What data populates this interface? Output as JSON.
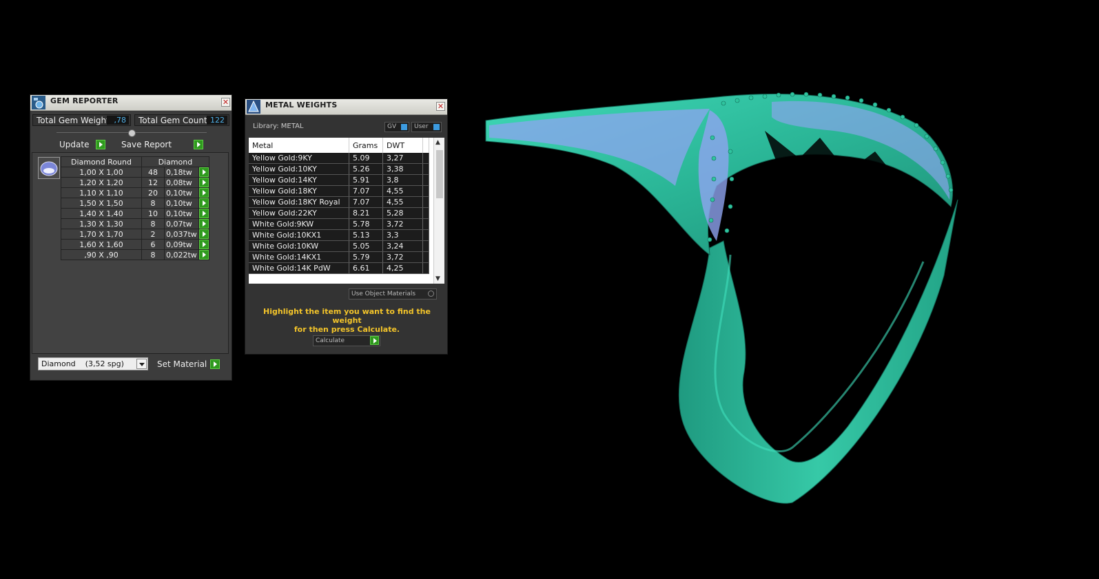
{
  "gem_reporter": {
    "title": "GEM REPORTER",
    "total_weight_label": "Total Gem Weight",
    "total_weight_value": ",78",
    "total_count_label": "Total Gem Count",
    "total_count_value": "122",
    "update_label": "Update",
    "save_report_label": "Save Report",
    "table_headers": [
      "Diamond Round",
      "Diamond"
    ],
    "rows": [
      {
        "size": "1,00 X 1,00",
        "count": "48",
        "weight": "0,18tw"
      },
      {
        "size": "1,20 X 1,20",
        "count": "12",
        "weight": "0,08tw"
      },
      {
        "size": "1,10 X 1,10",
        "count": "20",
        "weight": "0,10tw"
      },
      {
        "size": "1,50 X 1,50",
        "count": "8",
        "weight": "0,10tw"
      },
      {
        "size": "1,40 X 1,40",
        "count": "10",
        "weight": "0,10tw"
      },
      {
        "size": "1,30 X 1,30",
        "count": "8",
        "weight": "0,07tw"
      },
      {
        "size": "1,70 X 1,70",
        "count": "2",
        "weight": "0,037tw"
      },
      {
        "size": "1,60 X 1,60",
        "count": "6",
        "weight": "0,09tw"
      },
      {
        "size": ",90 X ,90",
        "count": "8",
        "weight": "0,022tw"
      }
    ],
    "material_value": "Diamond    (3,52 spg)",
    "set_material_label": "Set Material"
  },
  "metal_weights": {
    "title": "METAL WEIGHTS",
    "library_label": "Library: METAL",
    "toggle_gv": "GV",
    "toggle_user": "User",
    "columns": [
      "Metal",
      "Grams",
      "DWT"
    ],
    "rows": [
      {
        "metal": "Yellow Gold:9KY",
        "grams": "5.09",
        "dwt": "3,27"
      },
      {
        "metal": "Yellow Gold:10KY",
        "grams": "5.26",
        "dwt": "3,38"
      },
      {
        "metal": "Yellow Gold:14KY",
        "grams": "5.91",
        "dwt": "3,8"
      },
      {
        "metal": "Yellow Gold:18KY",
        "grams": "7.07",
        "dwt": "4,55"
      },
      {
        "metal": "Yellow Gold:18KY Royal",
        "grams": "7.07",
        "dwt": "4,55"
      },
      {
        "metal": "Yellow Gold:22KY",
        "grams": "8.21",
        "dwt": "5,28"
      },
      {
        "metal": "White Gold:9KW",
        "grams": "5.78",
        "dwt": "3,72"
      },
      {
        "metal": "White Gold:10KX1",
        "grams": "5.13",
        "dwt": "3,3"
      },
      {
        "metal": "White Gold:10KW",
        "grams": "5.05",
        "dwt": "3,24"
      },
      {
        "metal": "White Gold:14KX1",
        "grams": "5.79",
        "dwt": "3,72"
      },
      {
        "metal": "White Gold:14K PdW",
        "grams": "6.61",
        "dwt": "4,25"
      }
    ],
    "use_object_materials_label": "Use Object Materials",
    "hint_line1": "Highlight the item you want to find the weight",
    "hint_line2": "for then press Calculate.",
    "calculate_label": "Calculate"
  },
  "colors": {
    "background": "#000000",
    "panel": "#3c3c3c",
    "accent_green": "#2f9a1e",
    "hint_yellow": "#f3c42a",
    "ring_teal": "#2fc4a2",
    "gem_blue": "#8aa0f0"
  }
}
